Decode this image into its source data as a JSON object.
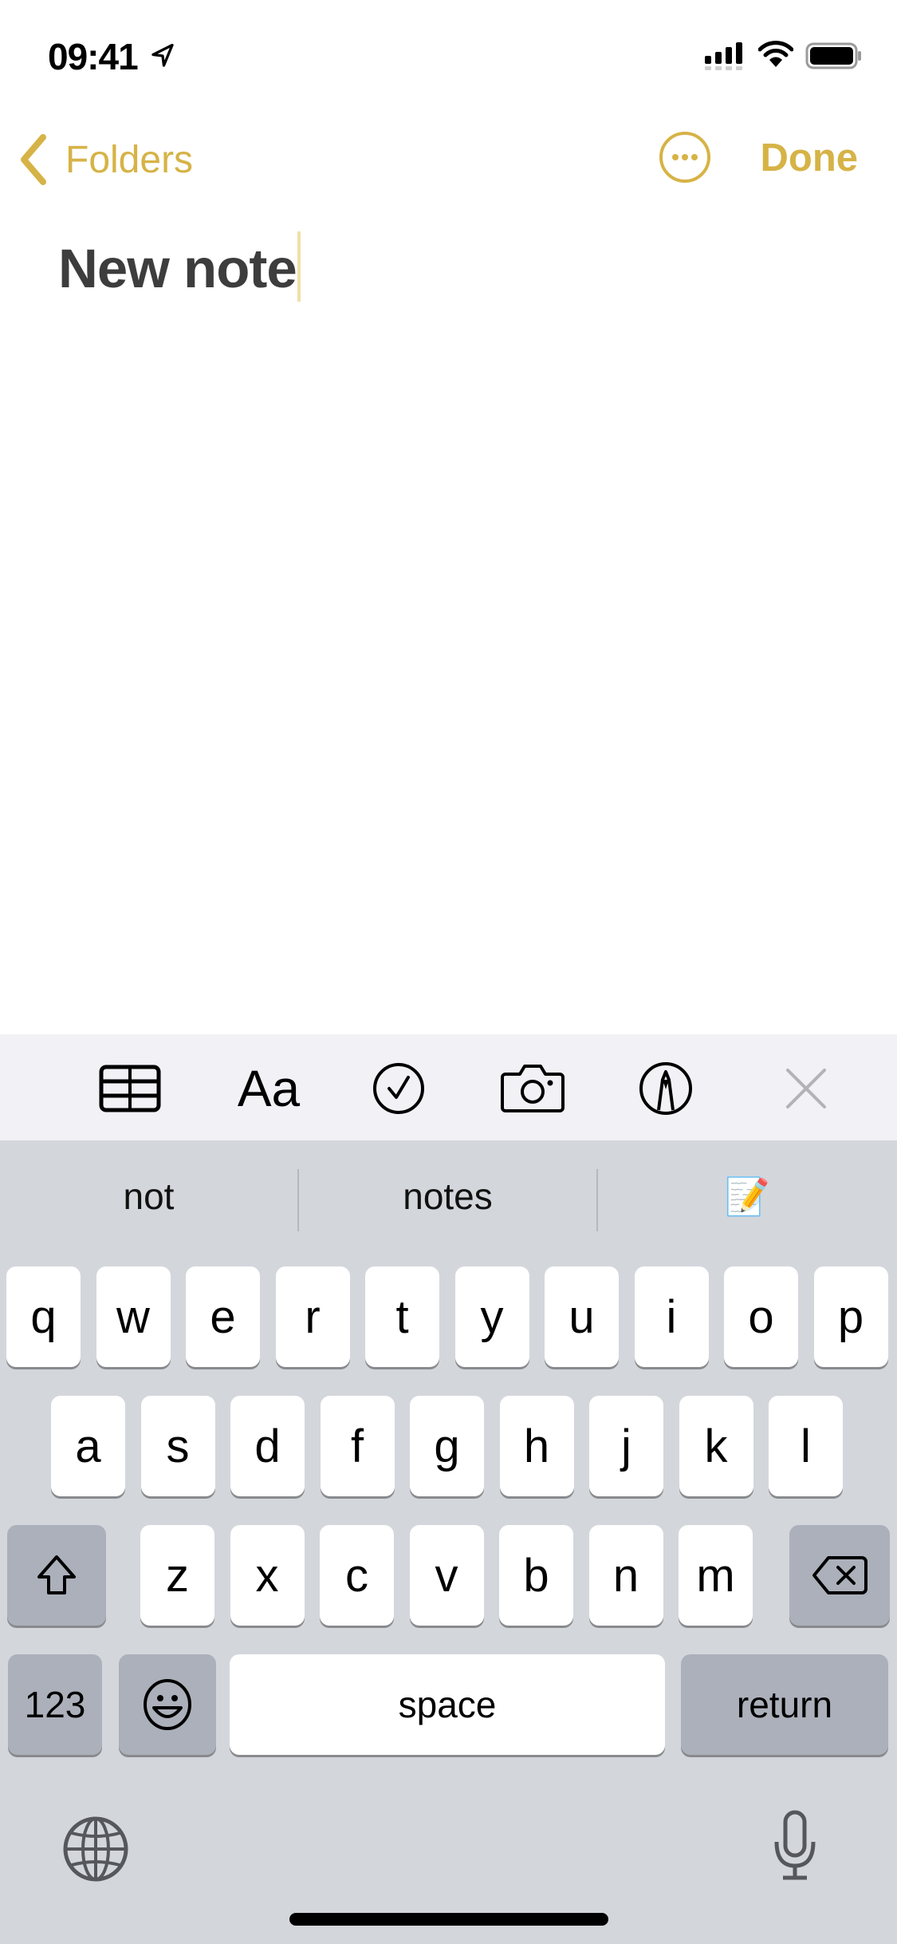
{
  "status_bar": {
    "time": "09:41",
    "icons": [
      "location-arrow-icon",
      "cellular-signal-icon",
      "wifi-icon",
      "battery-icon"
    ]
  },
  "nav": {
    "back_label": "Folders",
    "more_icon": "ellipsis-circle-icon",
    "done_label": "Done"
  },
  "note": {
    "title": "New note"
  },
  "toolbar": {
    "tools": [
      {
        "name": "table-icon"
      },
      {
        "name": "format-text",
        "label": "Aa"
      },
      {
        "name": "checklist-icon"
      },
      {
        "name": "camera-icon"
      },
      {
        "name": "markup-pen-icon"
      },
      {
        "name": "close-icon"
      }
    ]
  },
  "keyboard": {
    "suggestions": [
      "not",
      "notes",
      "📝"
    ],
    "row1": [
      "q",
      "w",
      "e",
      "r",
      "t",
      "y",
      "u",
      "i",
      "o",
      "p"
    ],
    "row2": [
      "a",
      "s",
      "d",
      "f",
      "g",
      "h",
      "j",
      "k",
      "l"
    ],
    "row3": [
      "z",
      "x",
      "c",
      "v",
      "b",
      "n",
      "m"
    ],
    "numbers_label": "123",
    "space_label": "space",
    "return_label": "return"
  },
  "colors": {
    "accent": "#D6B346",
    "keyboard_bg": "#D3D6DB",
    "toolbar_bg": "#F1F1F6",
    "special_key_bg": "#ABB0BA"
  }
}
